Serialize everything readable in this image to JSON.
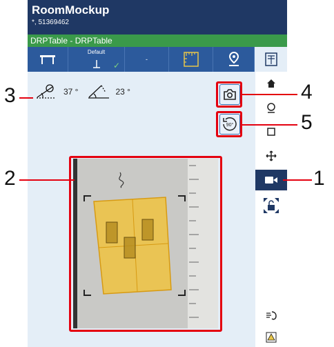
{
  "app": {
    "title": "RoomMockup",
    "subtitle": "*, 51369462"
  },
  "breadcrumb": "DRPTable - DRPTable",
  "tabs": [
    {
      "icon": "table-icon"
    },
    {
      "label": "Default",
      "icon": "plumb-icon",
      "checked": "✓"
    },
    {
      "label": "-",
      "icon": "empty"
    },
    {
      "icon": "ruler-frame-icon"
    },
    {
      "icon": "location-pin-icon"
    },
    {
      "icon": "mockup-icon"
    }
  ],
  "angles": {
    "tilt": "37 °",
    "rotation": "23 °"
  },
  "rail": [
    "home-icon",
    "ring-icon",
    "square-icon",
    "move-icon",
    "camera-video-icon",
    "unlock-expand-icon",
    "gesture-icon",
    "warning-icon"
  ],
  "callouts": [
    "1",
    "2",
    "3",
    "4",
    "5"
  ],
  "colors": {
    "header": "#1f3864",
    "green": "#3a9a4a",
    "tab": "#2c5a9c",
    "accent": "#e4000f"
  }
}
